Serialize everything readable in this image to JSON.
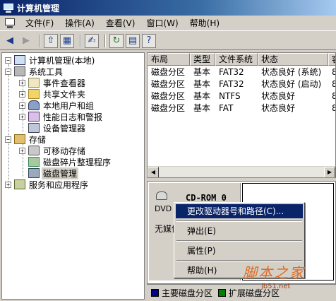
{
  "window": {
    "title": "计算机管理"
  },
  "menu": [
    "文件(F)",
    "操作(A)",
    "查看(V)",
    "窗口(W)",
    "帮助(H)"
  ],
  "tree": {
    "root": "计算机管理(本地)",
    "system_tools": "系统工具",
    "event_viewer": "事件查看器",
    "shared_folders": "共享文件夹",
    "local_users": "本地用户和组",
    "perf_logs": "性能日志和警报",
    "device_manager": "设备管理器",
    "storage": "存储",
    "removable": "可移动存储",
    "defrag": "磁盘碎片整理程序",
    "disk_mgmt": "磁盘管理",
    "services": "服务和应用程序"
  },
  "volumes": {
    "columns": [
      "布局",
      "类型",
      "文件系统",
      "状态",
      "容"
    ],
    "rows": [
      [
        "磁盘分区",
        "基本",
        "FAT32",
        "状态良好 (系统)",
        "8"
      ],
      [
        "磁盘分区",
        "基本",
        "FAT32",
        "状态良好 (启动)",
        "8"
      ],
      [
        "磁盘分区",
        "基本",
        "NTFS",
        "状态良好",
        "8"
      ],
      [
        "磁盘分区",
        "基本",
        "FAT",
        "状态良好",
        "8"
      ]
    ]
  },
  "disk": {
    "type": "DVD",
    "name": "CD-ROM 0",
    "media": "无媒体"
  },
  "context_menu": {
    "change_letter": "更改驱动器号和路径(C)...",
    "eject": "弹出(E)",
    "properties": "属性(P)",
    "help": "帮助(H)"
  },
  "legend": {
    "primary": "主要磁盘分区",
    "extended": "扩展磁盘分区",
    "primary_color": "#000080",
    "extended_color": "#008000"
  },
  "watermark": {
    "text": "脚本之家",
    "sub": "jb51.net"
  }
}
